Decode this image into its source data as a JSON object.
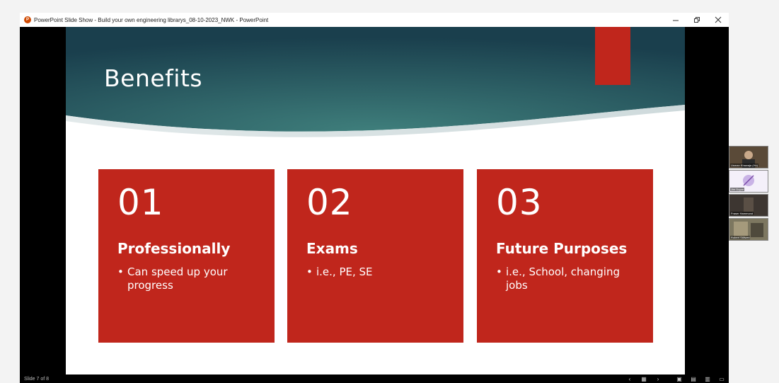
{
  "window": {
    "title": "PowerPoint Slide Show  -  Build your own engineering librarys_08-10-2023_NWK - PowerPoint",
    "minimize_icon": "minimize-icon",
    "restore_icon": "restore-icon",
    "close_icon": "close-icon",
    "app_icon": "powerpoint-icon"
  },
  "slide": {
    "title": "Benefits",
    "cards": [
      {
        "number": "01",
        "heading": "Professionally",
        "bullets": [
          "Can speed up your progress"
        ]
      },
      {
        "number": "02",
        "heading": "Exams",
        "bullets": [
          "i.e., PE, SE"
        ]
      },
      {
        "number": "03",
        "heading": "Future Purposes",
        "bullets": [
          "i.e., School, changing jobs"
        ]
      }
    ],
    "bullet_char": "•",
    "colors": {
      "accent": "#c0261c",
      "header_dark": "#1f4a57",
      "header_light": "#3f7f7c"
    }
  },
  "status": {
    "slide_counter": "Slide 7 of 8",
    "prev_icon": "chevron-left-icon",
    "slide_sorter_icon": "slide-sorter-icon",
    "next_icon": "chevron-right-icon",
    "normal_view_icon": "normal-view-icon",
    "grid_icon": "grid-icon",
    "reading_view_icon": "reading-view-icon",
    "slideshow_icon": "slideshow-icon"
  },
  "participants": [
    {
      "name": "Usman Khawaja (Ho)"
    },
    {
      "name": "Jim Dupre"
    },
    {
      "name": "Fraser Hammond"
    },
    {
      "name": "Robert Stillwell"
    }
  ]
}
